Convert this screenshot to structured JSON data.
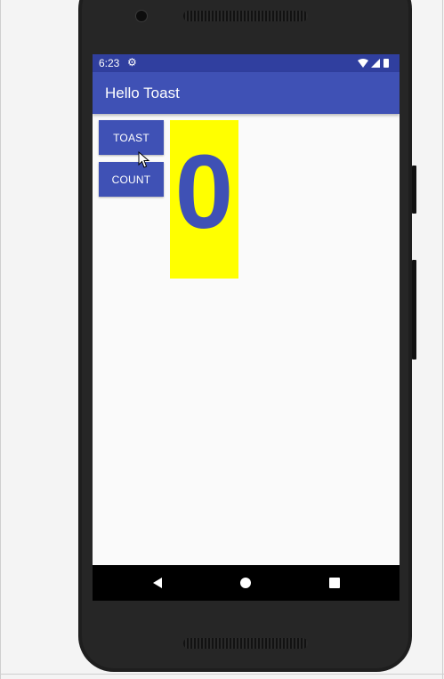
{
  "status_bar": {
    "time": "6:23",
    "settings_icon": "gear-icon",
    "wifi_icon": "wifi-icon",
    "signal_icon": "signal-icon",
    "battery_icon": "battery-icon"
  },
  "app_bar": {
    "title": "Hello Toast"
  },
  "buttons": {
    "toast_label": "TOAST",
    "count_label": "COUNT"
  },
  "counter": {
    "value": "0"
  },
  "navigation": {
    "back_icon": "back-triangle-icon",
    "home_icon": "home-circle-icon",
    "recents_icon": "recents-square-icon"
  },
  "colors": {
    "primary": "#3f51b5",
    "primary_dark": "#303f9f",
    "counter_background": "#ffff00",
    "screen_background": "#fafafa"
  }
}
